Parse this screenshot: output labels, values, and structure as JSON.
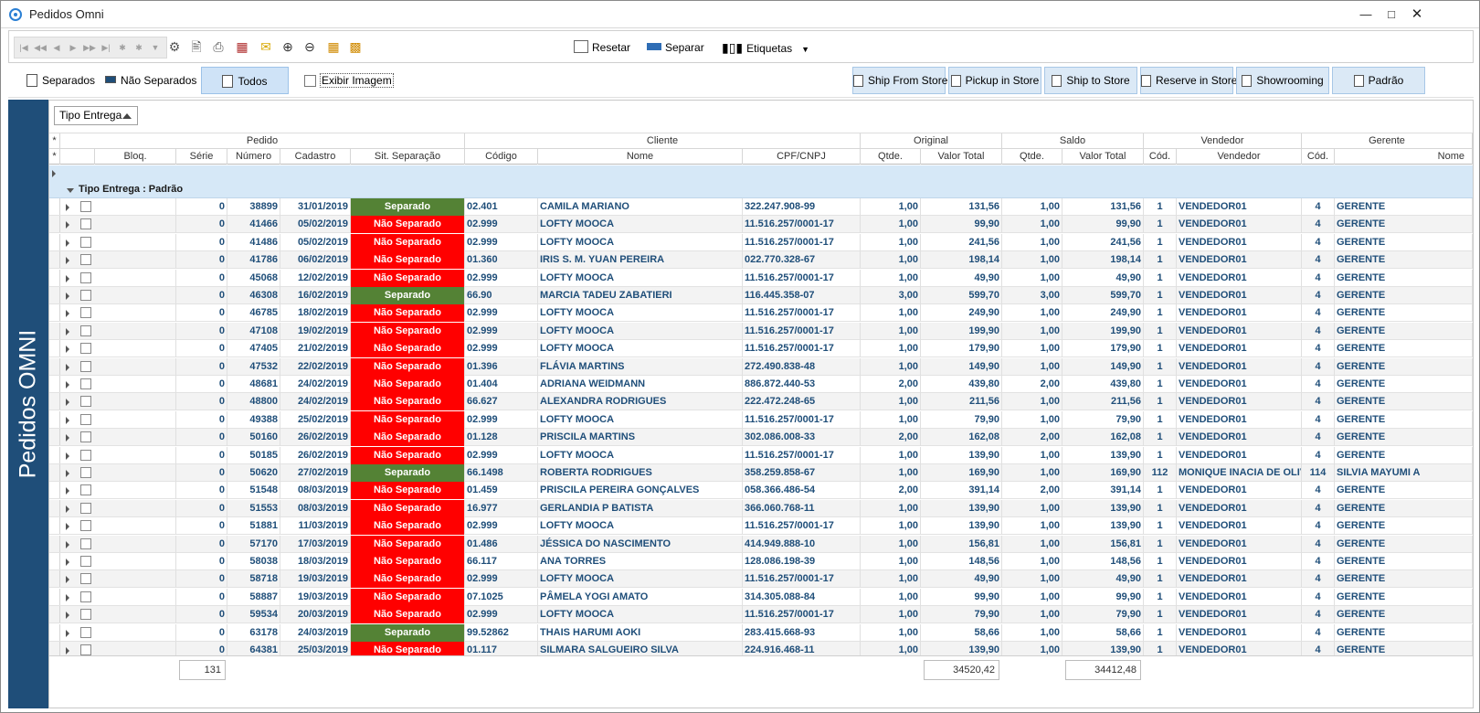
{
  "window": {
    "title": "Pedidos Omni"
  },
  "toolbar": {
    "resetar": "Resetar",
    "separar": "Separar",
    "etiquetas": "Etiquetas"
  },
  "filters": {
    "separados": "Separados",
    "nao_separados": "Não Separados",
    "todos": "Todos",
    "exibir_imagem": "Exibir Imagem"
  },
  "types": [
    "Ship From Store",
    "Pickup in Store",
    "Ship to Store",
    "Reserve in Store",
    "Showrooming",
    "Padrão"
  ],
  "side_label": "Pedidos OMNI",
  "group_by": "Tipo Entrega",
  "group_row": "Tipo Entrega : Padrão",
  "bands": {
    "pedido": "Pedido",
    "cliente": "Cliente",
    "original": "Original",
    "saldo": "Saldo",
    "vendedor": "Vendedor",
    "gerente": "Gerente"
  },
  "headers": {
    "bloq": "Bloq.",
    "serie": "Série",
    "numero": "Número",
    "cadastro": "Cadastro",
    "sit": "Sit. Separação",
    "codigo": "Código",
    "nome": "Nome",
    "cpf": "CPF/CNPJ",
    "o_qtde": "Qtde.",
    "o_valor": "Valor Total",
    "s_qtde": "Qtde.",
    "s_valor": "Valor Total",
    "v_cod": "Cód.",
    "vendedor": "Vendedor",
    "g_cod": "Cód.",
    "g_nome": "Nome"
  },
  "rows": [
    [
      "0",
      "38899",
      "31/01/2019",
      "Separado",
      "02.401",
      "CAMILA MARIANO",
      "322.247.908-99",
      "1,00",
      "131,56",
      "1,00",
      "131,56",
      "1",
      "VENDEDOR01",
      "4",
      "GERENTE"
    ],
    [
      "0",
      "41466",
      "05/02/2019",
      "Não Separado",
      "02.999",
      "LOFTY MOOCA",
      "11.516.257/0001-17",
      "1,00",
      "99,90",
      "1,00",
      "99,90",
      "1",
      "VENDEDOR01",
      "4",
      "GERENTE"
    ],
    [
      "0",
      "41486",
      "05/02/2019",
      "Não Separado",
      "02.999",
      "LOFTY MOOCA",
      "11.516.257/0001-17",
      "1,00",
      "241,56",
      "1,00",
      "241,56",
      "1",
      "VENDEDOR01",
      "4",
      "GERENTE"
    ],
    [
      "0",
      "41786",
      "06/02/2019",
      "Não Separado",
      "01.360",
      "IRIS S. M. YUAN PEREIRA",
      "022.770.328-67",
      "1,00",
      "198,14",
      "1,00",
      "198,14",
      "1",
      "VENDEDOR01",
      "4",
      "GERENTE"
    ],
    [
      "0",
      "45068",
      "12/02/2019",
      "Não Separado",
      "02.999",
      "LOFTY MOOCA",
      "11.516.257/0001-17",
      "1,00",
      "49,90",
      "1,00",
      "49,90",
      "1",
      "VENDEDOR01",
      "4",
      "GERENTE"
    ],
    [
      "0",
      "46308",
      "16/02/2019",
      "Separado",
      "66.90",
      "MARCIA TADEU ZABATIERI",
      "116.445.358-07",
      "3,00",
      "599,70",
      "3,00",
      "599,70",
      "1",
      "VENDEDOR01",
      "4",
      "GERENTE"
    ],
    [
      "0",
      "46785",
      "18/02/2019",
      "Não Separado",
      "02.999",
      "LOFTY MOOCA",
      "11.516.257/0001-17",
      "1,00",
      "249,90",
      "1,00",
      "249,90",
      "1",
      "VENDEDOR01",
      "4",
      "GERENTE"
    ],
    [
      "0",
      "47108",
      "19/02/2019",
      "Não Separado",
      "02.999",
      "LOFTY MOOCA",
      "11.516.257/0001-17",
      "1,00",
      "199,90",
      "1,00",
      "199,90",
      "1",
      "VENDEDOR01",
      "4",
      "GERENTE"
    ],
    [
      "0",
      "47405",
      "21/02/2019",
      "Não Separado",
      "02.999",
      "LOFTY MOOCA",
      "11.516.257/0001-17",
      "1,00",
      "179,90",
      "1,00",
      "179,90",
      "1",
      "VENDEDOR01",
      "4",
      "GERENTE"
    ],
    [
      "0",
      "47532",
      "22/02/2019",
      "Não Separado",
      "01.396",
      "FLÁVIA MARTINS",
      "272.490.838-48",
      "1,00",
      "149,90",
      "1,00",
      "149,90",
      "1",
      "VENDEDOR01",
      "4",
      "GERENTE"
    ],
    [
      "0",
      "48681",
      "24/02/2019",
      "Não Separado",
      "01.404",
      "ADRIANA WEIDMANN",
      "886.872.440-53",
      "2,00",
      "439,80",
      "2,00",
      "439,80",
      "1",
      "VENDEDOR01",
      "4",
      "GERENTE"
    ],
    [
      "0",
      "48800",
      "24/02/2019",
      "Não Separado",
      "66.627",
      "ALEXANDRA RODRIGUES",
      "222.472.248-65",
      "1,00",
      "211,56",
      "1,00",
      "211,56",
      "1",
      "VENDEDOR01",
      "4",
      "GERENTE"
    ],
    [
      "0",
      "49388",
      "25/02/2019",
      "Não Separado",
      "02.999",
      "LOFTY MOOCA",
      "11.516.257/0001-17",
      "1,00",
      "79,90",
      "1,00",
      "79,90",
      "1",
      "VENDEDOR01",
      "4",
      "GERENTE"
    ],
    [
      "0",
      "50160",
      "26/02/2019",
      "Não Separado",
      "01.128",
      "PRISCILA MARTINS",
      "302.086.008-33",
      "2,00",
      "162,08",
      "2,00",
      "162,08",
      "1",
      "VENDEDOR01",
      "4",
      "GERENTE"
    ],
    [
      "0",
      "50185",
      "26/02/2019",
      "Não Separado",
      "02.999",
      "LOFTY MOOCA",
      "11.516.257/0001-17",
      "1,00",
      "139,90",
      "1,00",
      "139,90",
      "1",
      "VENDEDOR01",
      "4",
      "GERENTE"
    ],
    [
      "0",
      "50620",
      "27/02/2019",
      "Separado",
      "66.1498",
      "ROBERTA RODRIGUES",
      "358.259.858-67",
      "1,00",
      "169,90",
      "1,00",
      "169,90",
      "112",
      "MONIQUE INACIA DE OLIV",
      "114",
      "SILVIA MAYUMI A"
    ],
    [
      "0",
      "51548",
      "08/03/2019",
      "Não Separado",
      "01.459",
      "PRISCILA PEREIRA GONÇALVES",
      "058.366.486-54",
      "2,00",
      "391,14",
      "2,00",
      "391,14",
      "1",
      "VENDEDOR01",
      "4",
      "GERENTE"
    ],
    [
      "0",
      "51553",
      "08/03/2019",
      "Não Separado",
      "16.977",
      "GERLANDIA P BATISTA",
      "366.060.768-11",
      "1,00",
      "139,90",
      "1,00",
      "139,90",
      "1",
      "VENDEDOR01",
      "4",
      "GERENTE"
    ],
    [
      "0",
      "51881",
      "11/03/2019",
      "Não Separado",
      "02.999",
      "LOFTY MOOCA",
      "11.516.257/0001-17",
      "1,00",
      "139,90",
      "1,00",
      "139,90",
      "1",
      "VENDEDOR01",
      "4",
      "GERENTE"
    ],
    [
      "0",
      "57170",
      "17/03/2019",
      "Não Separado",
      "01.486",
      "JÉSSICA DO NASCIMENTO",
      "414.949.888-10",
      "1,00",
      "156,81",
      "1,00",
      "156,81",
      "1",
      "VENDEDOR01",
      "4",
      "GERENTE"
    ],
    [
      "0",
      "58038",
      "18/03/2019",
      "Não Separado",
      "66.117",
      "ANA TORRES",
      "128.086.198-39",
      "1,00",
      "148,56",
      "1,00",
      "148,56",
      "1",
      "VENDEDOR01",
      "4",
      "GERENTE"
    ],
    [
      "0",
      "58718",
      "19/03/2019",
      "Não Separado",
      "02.999",
      "LOFTY MOOCA",
      "11.516.257/0001-17",
      "1,00",
      "49,90",
      "1,00",
      "49,90",
      "1",
      "VENDEDOR01",
      "4",
      "GERENTE"
    ],
    [
      "0",
      "58887",
      "19/03/2019",
      "Não Separado",
      "07.1025",
      "PÂMELA YOGI AMATO",
      "314.305.088-84",
      "1,00",
      "99,90",
      "1,00",
      "99,90",
      "1",
      "VENDEDOR01",
      "4",
      "GERENTE"
    ],
    [
      "0",
      "59534",
      "20/03/2019",
      "Não Separado",
      "02.999",
      "LOFTY MOOCA",
      "11.516.257/0001-17",
      "1,00",
      "79,90",
      "1,00",
      "79,90",
      "1",
      "VENDEDOR01",
      "4",
      "GERENTE"
    ],
    [
      "0",
      "63178",
      "24/03/2019",
      "Separado",
      "99.52862",
      "THAIS HARUMI AOKI",
      "283.415.668-93",
      "1,00",
      "58,66",
      "1,00",
      "58,66",
      "1",
      "VENDEDOR01",
      "4",
      "GERENTE"
    ],
    [
      "0",
      "64381",
      "25/03/2019",
      "Não Separado",
      "01.117",
      "SILMARA SALGUEIRO SILVA",
      "224.916.468-11",
      "1,00",
      "139,90",
      "1,00",
      "139,90",
      "1",
      "VENDEDOR01",
      "4",
      "GERENTE"
    ]
  ],
  "footer": {
    "count": "131",
    "original_total": "34520,42",
    "saldo_total": "34412,48"
  },
  "colors": {
    "separado": "#548235",
    "nao_separado": "#ff0000",
    "side_panel": "#1f4e79",
    "text": "#1f4e79"
  }
}
